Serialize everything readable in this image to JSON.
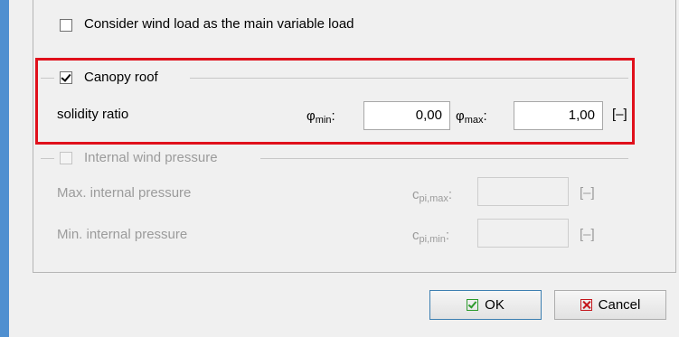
{
  "options": {
    "wind_main_variable_label": "Consider wind load as the main variable load",
    "wind_main_variable_checked": false
  },
  "canopy_roof": {
    "label": "Canopy roof",
    "checked": true,
    "solidity_ratio_label": "solidity ratio",
    "phi_symbol": "φ",
    "phi_min_sub": "min",
    "phi_min_value": "0,00",
    "phi_max_sub": "max",
    "phi_max_value": "1,00",
    "unit": "[–]"
  },
  "internal_wind_pressure": {
    "label": "Internal wind pressure",
    "checked": false,
    "enabled": false,
    "max_label": "Max. internal pressure",
    "max_symbol": "c",
    "max_sub": "pi,max",
    "max_value": "",
    "max_unit": "[–]",
    "min_label": "Min. internal pressure",
    "min_symbol": "c",
    "min_sub": "pi,min",
    "min_value": "",
    "min_unit": "[–]"
  },
  "buttons": {
    "ok_label": "OK",
    "cancel_label": "Cancel"
  },
  "colors": {
    "highlight": "#e0101b",
    "ok_icon": "#2c9a2c",
    "cancel_icon": "#c4161c",
    "window_edge": "#4f8fd0"
  }
}
